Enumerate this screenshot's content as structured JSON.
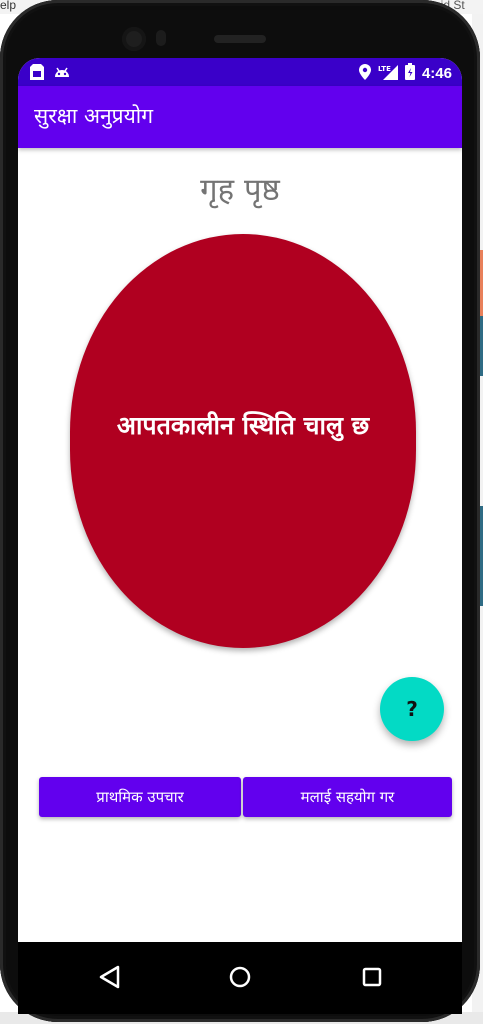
{
  "background": {
    "left_text": "elp",
    "right_text": "roid St"
  },
  "status_bar": {
    "network": "LTE",
    "time": "4:46"
  },
  "app_bar": {
    "title": "सुरक्षा अनुप्रयोग"
  },
  "page": {
    "heading": "गृह पृष्ठ"
  },
  "emergency": {
    "label": "आपतकालीन स्थिति चालु छ",
    "color": "#b00020"
  },
  "fab": {
    "label": "?",
    "color": "#03dac5"
  },
  "buttons": {
    "first_aid": "प्राथमिक उपचार",
    "help_me": "मलाई सहयोग गर"
  },
  "nav": {
    "items": [
      "back-icon",
      "home-icon",
      "recents-icon"
    ]
  },
  "colors": {
    "status_bar": "#3a00c9",
    "primary": "#6200ee"
  }
}
